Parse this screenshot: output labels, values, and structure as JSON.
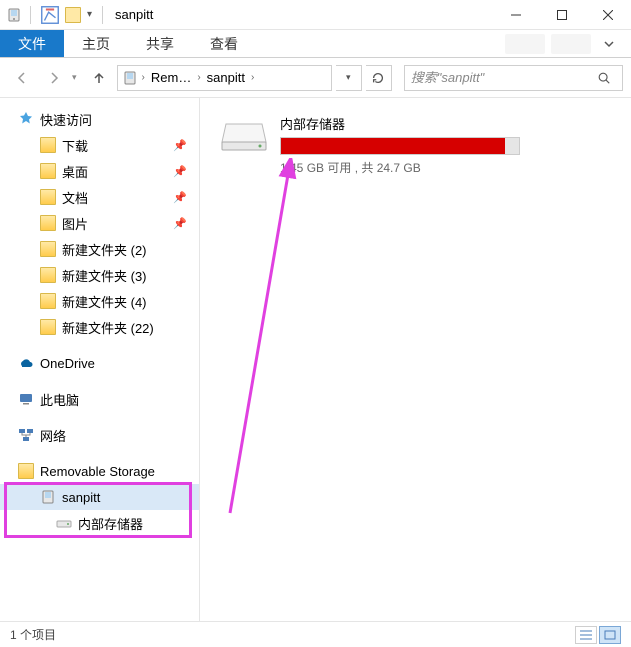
{
  "window": {
    "title": "sanpitt"
  },
  "ribbon": {
    "file": "文件",
    "tabs": [
      "主页",
      "共享",
      "查看"
    ]
  },
  "breadcrumbs": {
    "segments": [
      "Rem…",
      "sanpitt"
    ]
  },
  "search": {
    "placeholder": "搜索\"sanpitt\""
  },
  "sidebar": {
    "quick_access": {
      "label": "快速访问",
      "items": [
        {
          "label": "下载",
          "pinned": true
        },
        {
          "label": "桌面",
          "pinned": true
        },
        {
          "label": "文档",
          "pinned": true
        },
        {
          "label": "图片",
          "pinned": true
        },
        {
          "label": "新建文件夹 (2)",
          "pinned": false
        },
        {
          "label": "新建文件夹 (3)",
          "pinned": false
        },
        {
          "label": "新建文件夹 (4)",
          "pinned": false
        },
        {
          "label": "新建文件夹 (22)",
          "pinned": false
        }
      ]
    },
    "onedrive": {
      "label": "OneDrive"
    },
    "this_pc": {
      "label": "此电脑"
    },
    "network": {
      "label": "网络"
    },
    "removable": {
      "label": "Removable Storage",
      "device": {
        "label": "sanpitt"
      },
      "storage": {
        "label": "内部存储器"
      }
    }
  },
  "content": {
    "drive": {
      "name": "内部存储器",
      "free_text": "1.45 GB 可用 , 共 24.7 GB",
      "used_percent": 94
    }
  },
  "statusbar": {
    "count_text": "1 个项目"
  }
}
